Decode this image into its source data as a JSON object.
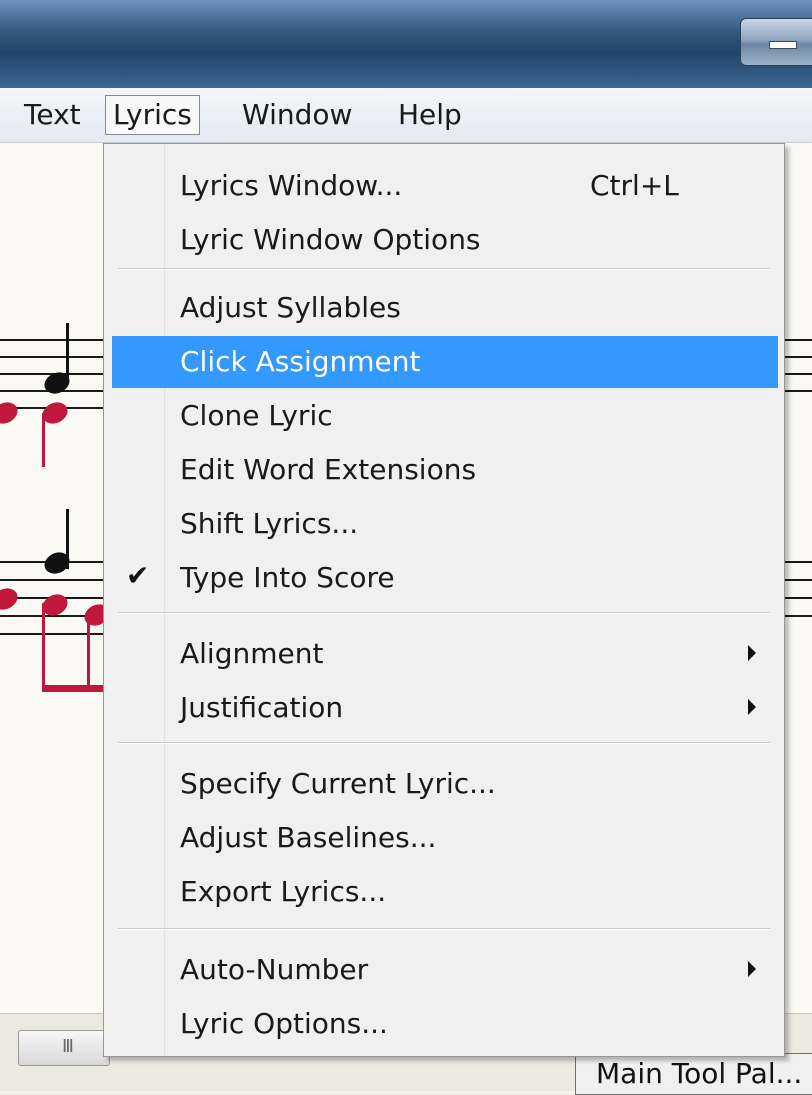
{
  "menubar": {
    "items": [
      {
        "label": "Text",
        "active": false
      },
      {
        "label": "Lyrics",
        "active": true
      },
      {
        "label": "Window",
        "active": false
      },
      {
        "label": "Help",
        "active": false
      }
    ]
  },
  "lyrics_menu": {
    "items": [
      {
        "label": "Lyrics Window...",
        "shortcut": "Ctrl+L"
      },
      {
        "label": "Lyric Window Options"
      },
      {
        "label": "Adjust Syllables"
      },
      {
        "label": "Click Assignment",
        "highlighted": true
      },
      {
        "label": "Clone Lyric"
      },
      {
        "label": "Edit Word Extensions"
      },
      {
        "label": "Shift Lyrics..."
      },
      {
        "label": "Type Into Score",
        "checked": true,
        "check_glyph": "✔"
      },
      {
        "label": "Alignment",
        "submenu": true
      },
      {
        "label": "Justification",
        "submenu": true
      },
      {
        "label": "Specify Current Lyric..."
      },
      {
        "label": "Adjust Baselines..."
      },
      {
        "label": "Export Lyrics..."
      },
      {
        "label": "Auto-Number",
        "submenu": true
      },
      {
        "label": "Lyric Options..."
      }
    ]
  },
  "status": {
    "tool_palette_label": "Main Tool Pal...",
    "scroll_grip": "III"
  },
  "colors": {
    "highlight": "#3399ff",
    "note_red": "#c0183c",
    "title_blue": "#2b4f77"
  }
}
